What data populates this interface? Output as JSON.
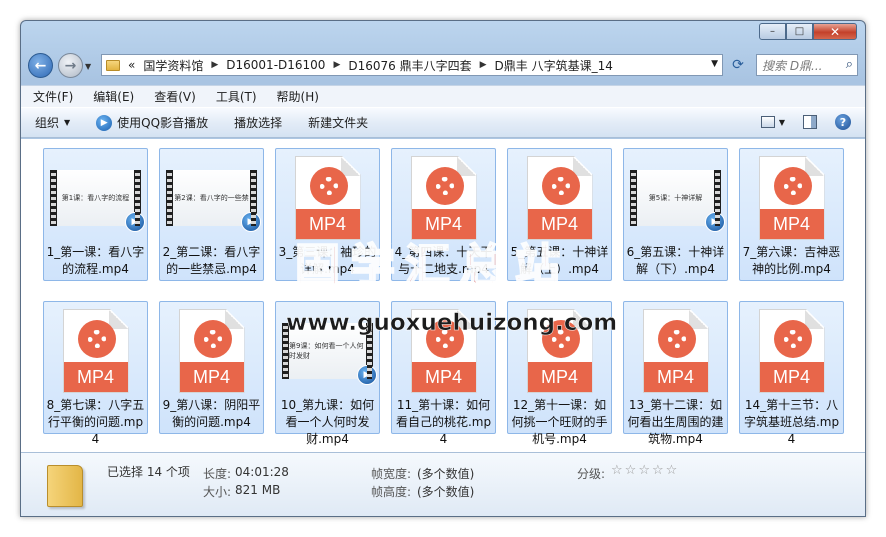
{
  "window": {
    "buttons": {
      "minimize": "–",
      "maximize": "□",
      "close": "✕"
    }
  },
  "address": {
    "overflow": "«",
    "crumbs": [
      "国学资料馆",
      "D16001-D16100",
      "D16076 鼎丰八字四套",
      "D鼎丰 八字筑基课_14"
    ],
    "search_placeholder": "搜索 D鼎..."
  },
  "menu": [
    "文件(F)",
    "编辑(E)",
    "查看(V)",
    "工具(T)",
    "帮助(H)"
  ],
  "toolbar": {
    "organize": "组织",
    "play_qq": "使用QQ影音播放",
    "play_selection": "播放选择",
    "new_folder": "新建文件夹"
  },
  "files": [
    {
      "name": "1_第一课：看八字的流程.mp4",
      "kind": "video",
      "frame": "第1课：看八字的流程"
    },
    {
      "name": "2_第二课：看八字的一些禁忌.mp4",
      "kind": "video",
      "frame": "第2课：看八字的一些禁"
    },
    {
      "name": "3_第三课：袖珍的详解.mp4",
      "kind": "doc"
    },
    {
      "name": "4_第四课：十天干与十二地支.mp4",
      "kind": "doc"
    },
    {
      "name": "5_第五课：十神详解（上）.mp4",
      "kind": "doc"
    },
    {
      "name": "6_第五课：十神详解（下）.mp4",
      "kind": "video",
      "frame": "第5课：十神详解"
    },
    {
      "name": "7_第六课：吉神恶神的比例.mp4",
      "kind": "doc"
    },
    {
      "name": "8_第七课：八字五行平衡的问题.mp4",
      "kind": "doc"
    },
    {
      "name": "9_第八课：阴阳平衡的问题.mp4",
      "kind": "doc"
    },
    {
      "name": "10_第九课：如何看一个人何时发财.mp4",
      "kind": "video",
      "frame": "第9课：如何看一个人何时发财"
    },
    {
      "name": "11_第十课：如何看自己的桃花.mp4",
      "kind": "doc"
    },
    {
      "name": "12_第十一课：如何挑一个旺财的手机号.mp4",
      "kind": "doc"
    },
    {
      "name": "13_第十二课：如何看出生周围的建筑物.mp4",
      "kind": "doc"
    },
    {
      "name": "14_第十三节：八字筑基班总结.mp4",
      "kind": "doc"
    }
  ],
  "doc_badge": "MP4",
  "watermark": {
    "main": "国学汇总站",
    "url": "www.guoxuehuizong.com"
  },
  "details": {
    "selected": "已选择 14 个项",
    "length_label": "长度:",
    "length": "04:01:28",
    "size_label": "大小:",
    "size": "821 MB",
    "width_label": "帧宽度:",
    "width": "(多个数值)",
    "height_label": "帧高度:",
    "height": "(多个数值)",
    "rating_label": "分级:",
    "rating_stars": 0
  }
}
